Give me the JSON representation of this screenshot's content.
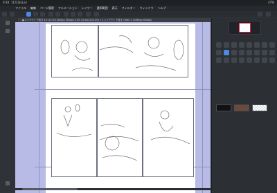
{
  "status_bar": {
    "time": "0:58",
    "date": "11月3日(火)",
    "battery": "47%"
  },
  "menu": [
    "ファイル",
    "編集",
    "ページ管理",
    "アニメーション",
    "レイヤー",
    "選択範囲",
    "表示",
    "フィルター",
    "ウィンドウ",
    "ヘルプ"
  ],
  "tab": {
    "title": "● レイアウト 下書き 4.4 (1272×1800px 350dpi) 4.2% 14.9(0)(100.0%) 1 1 レイアウト 下書き (7680 × 10860px 600dpi)"
  },
  "colors": {
    "canvas_bg": "#b8bbe6",
    "accent": "#4a8be0",
    "swatch_black": "#111111",
    "swatch_brown": "#6b4a3b"
  },
  "icons": [
    "close-icon",
    "pen-icon",
    "eraser-icon",
    "brush-icon",
    "lasso-icon",
    "hand-icon",
    "zoom-icon"
  ]
}
